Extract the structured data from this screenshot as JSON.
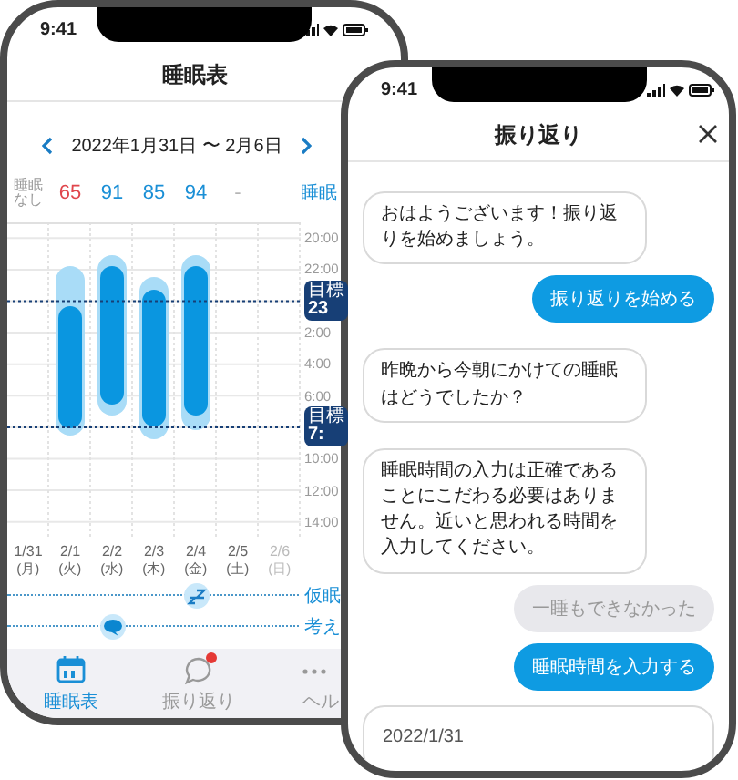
{
  "sleep_table_screen": {
    "status_time": "9:41",
    "title": "睡眠表",
    "date_range": "2022年1月31日 〜 2月6日",
    "scores": [
      {
        "text": "睡眠なし",
        "color": "#9b9b9b"
      },
      {
        "text": "65",
        "color": "#e0464c"
      },
      {
        "text": "91",
        "color": "#1a8fd6"
      },
      {
        "text": "85",
        "color": "#1a8fd6"
      },
      {
        "text": "94",
        "color": "#1a8fd6"
      },
      {
        "text": "-",
        "color": "#b5b5b5"
      }
    ],
    "side_label": "睡眠",
    "time_ticks": [
      {
        "kind": "time",
        "text": "20:00"
      },
      {
        "kind": "time",
        "text": "22:00"
      },
      {
        "kind": "target",
        "label": "目標",
        "value": "23"
      },
      {
        "kind": "time",
        "text": "2:00"
      },
      {
        "kind": "time",
        "text": "4:00"
      },
      {
        "kind": "time",
        "text": "6:00"
      },
      {
        "kind": "target",
        "label": "目標",
        "value": "7:"
      },
      {
        "kind": "time",
        "text": "10:00"
      },
      {
        "kind": "time",
        "text": "12:00"
      },
      {
        "kind": "time",
        "text": "14:00"
      }
    ],
    "days": [
      {
        "date": "1/31",
        "weekday": "(月)",
        "disabled": false
      },
      {
        "date": "2/1",
        "weekday": "(火)",
        "disabled": false
      },
      {
        "date": "2/2",
        "weekday": "(水)",
        "disabled": false
      },
      {
        "date": "2/3",
        "weekday": "(木)",
        "disabled": false
      },
      {
        "date": "2/4",
        "weekday": "(金)",
        "disabled": false
      },
      {
        "date": "2/5",
        "weekday": "(土)",
        "disabled": false
      },
      {
        "date": "2/6",
        "weekday": "(日)",
        "disabled": true
      }
    ],
    "legend": [
      {
        "kind": "nap",
        "label": "仮眠"
      },
      {
        "kind": "thought",
        "label": "考え"
      }
    ],
    "tabs": [
      {
        "kind": "calendar",
        "label": "睡眠表",
        "selected": true,
        "badge": false
      },
      {
        "kind": "chat",
        "label": "振り返り",
        "selected": false,
        "badge": true
      },
      {
        "kind": "more",
        "label": "ヘル",
        "selected": false,
        "badge": false
      }
    ]
  },
  "review_screen": {
    "status_time": "9:41",
    "title": "振り返り",
    "messages": [
      {
        "kind": "bot",
        "text": "おはようございます！振り返りを始めましょう。"
      },
      {
        "kind": "action",
        "text": "振り返りを始める"
      },
      {
        "kind": "bot",
        "text": "昨晩から今朝にかけての睡眠はどうでしたか？"
      },
      {
        "kind": "bot",
        "text": "睡眠時間の入力は正確であることにこだわる必要はありません。近いと思われる時間を入力してください。"
      },
      {
        "kind": "option",
        "text": "一睡もできなかった"
      },
      {
        "kind": "action",
        "text": "睡眠時間を入力する"
      }
    ],
    "date_card": "2022/1/31"
  }
}
